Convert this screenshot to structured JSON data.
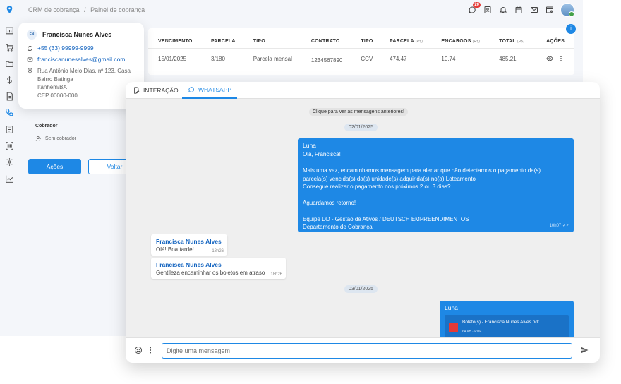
{
  "breadcrumb": [
    "CRM de cobrança",
    "/",
    "Painel de cobrança"
  ],
  "notifications": {
    "count": "20"
  },
  "table": {
    "headers": [
      {
        "label": "VENCIMENTO",
        "unit": ""
      },
      {
        "label": "PARCELA",
        "unit": ""
      },
      {
        "label": "TIPO",
        "unit": ""
      },
      {
        "label": "CONTRATO",
        "unit": ""
      },
      {
        "label": "TIPO",
        "unit": ""
      },
      {
        "label": "PARCELA",
        "unit": "(R$)"
      },
      {
        "label": "ENCARGOS",
        "unit": "(R$)"
      },
      {
        "label": "TOTAL",
        "unit": "(R$)"
      },
      {
        "label": "AÇÕES",
        "unit": ""
      }
    ],
    "row": {
      "vencimento": "15/01/2025",
      "parcela": "3/180",
      "tipo": "Parcela mensal",
      "contrato": "1234567890",
      "tipo2": "CCV",
      "valor": "474,47",
      "encargos": "10,74",
      "total": "485,21"
    },
    "info_label": "i"
  },
  "contact": {
    "initials": "FN",
    "name": "Francisca Nunes Alves",
    "phone": "+55 (33) 99999-9999",
    "email": "franciscanunesalves@gmail.com",
    "address_lines": [
      "Rua Antônio Melo Dias, nº 123, Casa",
      "Bairro Batinga",
      "Itanhém/BA",
      "CEP 00000-000"
    ]
  },
  "cobrador": {
    "title": "Cobrador",
    "value": "Sem cobrador"
  },
  "actions": {
    "primary": "Ações",
    "secondary": "Voltar"
  },
  "chat": {
    "tabs": [
      {
        "label": "INTERAÇÃO"
      },
      {
        "label": "WHATSAPP"
      }
    ],
    "load_previous": "Clique para ver as mensagens anteriores!",
    "dates": [
      "02/01/2025",
      "03/01/2025"
    ],
    "out_message_1": {
      "sender": "Luna",
      "lines": [
        "Olá, Francisca!",
        "",
        "Mais uma vez, encaminhamos mensagem para alertar que não detectamos o pagamento da(s)",
        "parcela(s) vencida(s) da(s) unidade(s) adquirida(s) no(a) Loteamento",
        "Consegue realizar o pagamento nos próximos 2 ou 3 dias?",
        "",
        "Aguardamos retorno!",
        "",
        "Equipe DD - Gestão de Ativos / DEUTSCH EMPREENDIMENTOS",
        "Departamento de Cobrança"
      ],
      "time": "10h07"
    },
    "in_messages": [
      {
        "sender": "Francisca Nunes Alves",
        "text": "Olá! Boa tarde!",
        "time": "18h26"
      },
      {
        "sender": "Francisca Nunes Alves",
        "text": "Gentileza encaminhar os boletos em atraso",
        "time": "18h26"
      }
    ],
    "out_message_2": {
      "sender": "Luna",
      "attachment": {
        "name": "Boleto(s) - Francisca Nunes Alves.pdf",
        "size": "64 kB",
        "type": "PDF"
      }
    },
    "composer": {
      "placeholder": "Digite uma mensagem"
    }
  },
  "colors": {
    "primary": "#1e88e5",
    "outgoing_bubble": "#1e88e5",
    "badge": "#e53935"
  }
}
